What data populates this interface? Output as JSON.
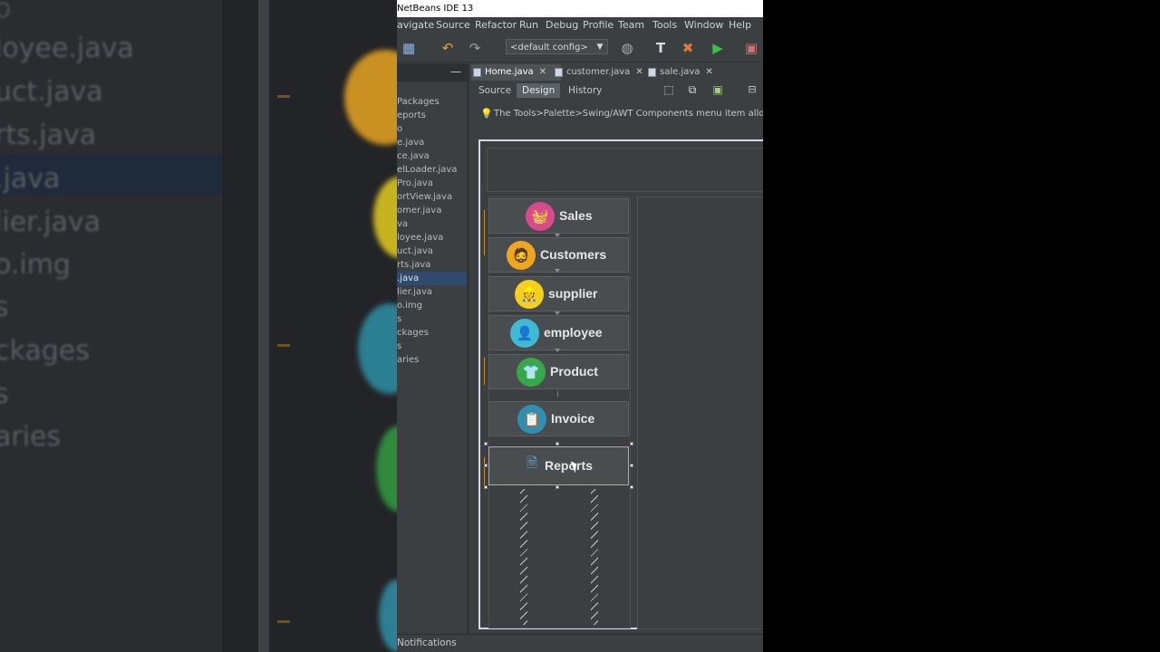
{
  "app": {
    "title": "NetBeans IDE 13"
  },
  "menu": [
    "avigate",
    "Source",
    "Refactor",
    "Run",
    "Debug",
    "Profile",
    "Team",
    "Tools",
    "Window",
    "Help"
  ],
  "toolbar": {
    "config": "<default config>"
  },
  "project_tree": [
    "Packages",
    "eports",
    "o",
    "e.java",
    "ce.java",
    "elLoader.java",
    "Pro.java",
    "ortView.java",
    "omer.java",
    "va",
    "loyee.java",
    "uct.java",
    "rts.java",
    ".java",
    "lier.java",
    "o.img",
    "s",
    "ckages",
    "s",
    "aries"
  ],
  "selected_tree_index": 13,
  "editor_tabs": [
    "Home.java",
    "customer.java",
    "sale.java"
  ],
  "active_tab": 0,
  "view_buttons": [
    "Source",
    "Design",
    "History"
  ],
  "active_view": 1,
  "hint": "The Tools>Palette>Swing/AWT Components menu item allows y",
  "nav_buttons": [
    "Sales",
    "Customers",
    "supplier",
    "employee",
    "Product",
    "Invoice",
    "Reports"
  ],
  "status": "Notifications",
  "background_text": [
    "loyee.java",
    "uct.java",
    "rts.java",
    ".java",
    "lier.java",
    "o.img",
    "s",
    "ckages",
    "s",
    "aries"
  ],
  "colors": {
    "ide_bg": "#3c3f41",
    "selection": "#2f4a6d",
    "accent_orange": "#e0a832"
  },
  "icons": {
    "sales": "basket-icon",
    "customers": "man-avatar-icon",
    "supplier": "worker-icon",
    "employee": "person-icon",
    "product": "shirt-icon",
    "invoice": "clipboard-icon",
    "reports": "document-icon"
  }
}
